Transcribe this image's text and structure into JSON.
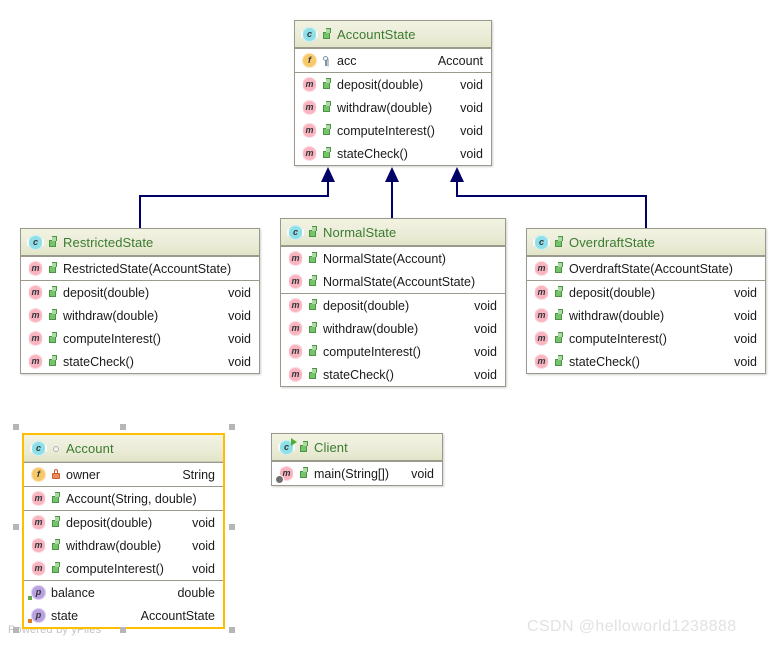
{
  "diagram": {
    "type": "uml-class-diagram",
    "accent_selection_color": "#FFBF00",
    "edge_color": "#000066",
    "header_gradient": "#f2f3e0 → #e3e5c9",
    "class_name_color": "#3b7a2f"
  },
  "classes": {
    "account_state": {
      "name": "AccountState",
      "class_icon": "class-badge-icon",
      "visibility_icon": "public-icon",
      "sections": [
        {
          "rows": [
            {
              "icon": "field-badge-icon",
              "visibility": "protected-icon",
              "label": "acc",
              "type": "Account"
            }
          ]
        },
        {
          "rows": [
            {
              "icon": "method-badge-icon",
              "visibility": "public-icon",
              "label": "deposit(double)",
              "type": "void"
            },
            {
              "icon": "method-badge-icon",
              "visibility": "public-icon",
              "label": "withdraw(double)",
              "type": "void"
            },
            {
              "icon": "method-badge-icon",
              "visibility": "public-icon",
              "label": "computeInterest()",
              "type": "void"
            },
            {
              "icon": "method-badge-icon",
              "visibility": "public-icon",
              "label": "stateCheck()",
              "type": "void"
            }
          ]
        }
      ]
    },
    "restricted_state": {
      "name": "RestrictedState",
      "class_icon": "class-badge-icon",
      "visibility_icon": "public-icon",
      "sections": [
        {
          "rows": [
            {
              "icon": "method-badge-icon",
              "visibility": "public-icon",
              "label": "RestrictedState(AccountState)",
              "type": ""
            }
          ]
        },
        {
          "rows": [
            {
              "icon": "method-badge-icon",
              "visibility": "public-icon",
              "label": "deposit(double)",
              "type": "void"
            },
            {
              "icon": "method-badge-icon",
              "visibility": "public-icon",
              "label": "withdraw(double)",
              "type": "void"
            },
            {
              "icon": "method-badge-icon",
              "visibility": "public-icon",
              "label": "computeInterest()",
              "type": "void"
            },
            {
              "icon": "method-badge-icon",
              "visibility": "public-icon",
              "label": "stateCheck()",
              "type": "void"
            }
          ]
        }
      ]
    },
    "normal_state": {
      "name": "NormalState",
      "class_icon": "class-badge-icon",
      "visibility_icon": "public-icon",
      "sections": [
        {
          "rows": [
            {
              "icon": "method-badge-icon",
              "visibility": "public-icon",
              "label": "NormalState(Account)",
              "type": ""
            },
            {
              "icon": "method-badge-icon",
              "visibility": "public-icon",
              "label": "NormalState(AccountState)",
              "type": ""
            }
          ]
        },
        {
          "rows": [
            {
              "icon": "method-badge-icon",
              "visibility": "public-icon",
              "label": "deposit(double)",
              "type": "void"
            },
            {
              "icon": "method-badge-icon",
              "visibility": "public-icon",
              "label": "withdraw(double)",
              "type": "void"
            },
            {
              "icon": "method-badge-icon",
              "visibility": "public-icon",
              "label": "computeInterest()",
              "type": "void"
            },
            {
              "icon": "method-badge-icon",
              "visibility": "public-icon",
              "label": "stateCheck()",
              "type": "void"
            }
          ]
        }
      ]
    },
    "overdraft_state": {
      "name": "OverdraftState",
      "class_icon": "class-badge-icon",
      "visibility_icon": "public-icon",
      "sections": [
        {
          "rows": [
            {
              "icon": "method-badge-icon",
              "visibility": "public-icon",
              "label": "OverdraftState(AccountState)",
              "type": ""
            }
          ]
        },
        {
          "rows": [
            {
              "icon": "method-badge-icon",
              "visibility": "public-icon",
              "label": "deposit(double)",
              "type": "void"
            },
            {
              "icon": "method-badge-icon",
              "visibility": "public-icon",
              "label": "withdraw(double)",
              "type": "void"
            },
            {
              "icon": "method-badge-icon",
              "visibility": "public-icon",
              "label": "computeInterest()",
              "type": "void"
            },
            {
              "icon": "method-badge-icon",
              "visibility": "public-icon",
              "label": "stateCheck()",
              "type": "void"
            }
          ]
        }
      ]
    },
    "account": {
      "name": "Account",
      "selected": true,
      "class_icon": "class-badge-icon",
      "visibility_icon": "package-icon",
      "sections": [
        {
          "rows": [
            {
              "icon": "field-badge-icon",
              "visibility": "private-icon",
              "label": "owner",
              "type": "String"
            }
          ]
        },
        {
          "rows": [
            {
              "icon": "method-badge-icon",
              "visibility": "public-icon",
              "label": "Account(String, double)",
              "type": ""
            }
          ]
        },
        {
          "rows": [
            {
              "icon": "method-badge-icon",
              "visibility": "public-icon",
              "label": "deposit(double)",
              "type": "void"
            },
            {
              "icon": "method-badge-icon",
              "visibility": "public-icon",
              "label": "withdraw(double)",
              "type": "void"
            },
            {
              "icon": "method-badge-icon",
              "visibility": "public-icon",
              "label": "computeInterest()",
              "type": "void"
            }
          ]
        },
        {
          "rows": [
            {
              "icon": "property-badge-icon",
              "marker": "green-square",
              "label": "balance",
              "type": "double"
            },
            {
              "icon": "property-badge-icon",
              "marker": "orange-square",
              "label": "state",
              "type": "AccountState"
            }
          ]
        }
      ]
    },
    "client": {
      "name": "Client",
      "class_icon": "class-runnable-badge-icon",
      "visibility_icon": "public-icon",
      "sections": [
        {
          "rows": [
            {
              "icon": "static-method-badge-icon",
              "visibility": "public-icon",
              "label": "main(String[])",
              "type": "void"
            }
          ]
        }
      ]
    }
  },
  "edges": [
    {
      "name": "generalization-restricted-to-accountstate",
      "from": "RestrictedState",
      "to": "AccountState",
      "kind": "generalization"
    },
    {
      "name": "generalization-normal-to-accountstate",
      "from": "NormalState",
      "to": "AccountState",
      "kind": "generalization"
    },
    {
      "name": "generalization-overdraft-to-accountstate",
      "from": "OverdraftState",
      "to": "AccountState",
      "kind": "generalization"
    }
  ],
  "watermarks": {
    "yfiles": "Powered by yFiles",
    "csdn": "CSDN @helloworld1238888"
  }
}
